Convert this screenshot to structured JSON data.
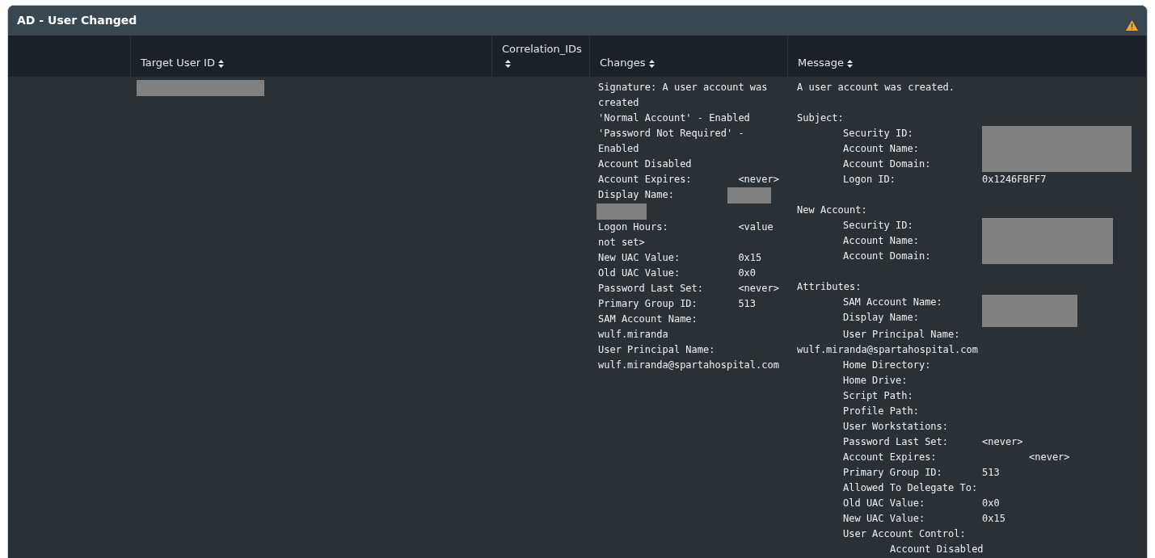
{
  "panel": {
    "title": "AD - User Changed",
    "warning": true
  },
  "columns": [
    {
      "label": "Target User ID"
    },
    {
      "label": "Correlation_IDs"
    },
    {
      "label": "Changes"
    },
    {
      "label": "Message"
    }
  ],
  "row": {
    "target_user_id": {
      "redacted": true
    },
    "changes": [
      {
        "kind": "text",
        "text": "Signature: A user account was created"
      },
      {
        "kind": "text",
        "text": "'Normal Account' - Enabled"
      },
      {
        "kind": "text",
        "text": "'Password Not Required' - Enabled"
      },
      {
        "kind": "text",
        "text": "Account Disabled"
      },
      {
        "kind": "text",
        "text": "Account Expires:        <never>"
      },
      {
        "kind": "redacted",
        "text": "Display Name:"
      },
      {
        "kind": "text",
        "text": "Logon Hours:            <value not set>"
      },
      {
        "kind": "text",
        "text": "New UAC Value:          0x15"
      },
      {
        "kind": "text",
        "text": "Old UAC Value:          0x0"
      },
      {
        "kind": "text",
        "text": "Password Last Set:      <never>"
      },
      {
        "kind": "text",
        "text": "Primary Group ID:       513"
      },
      {
        "kind": "text",
        "text": "SAM Account Name:       wulf.miranda"
      },
      {
        "kind": "text",
        "text": "User Principal Name:    wulf.miranda@spartahospital.com"
      }
    ],
    "message": {
      "intro": "A user account was created.",
      "sections": [
        {
          "heading": "Subject:",
          "fields": [
            {
              "label": "Security ID:",
              "redacted": true
            },
            {
              "label": "Account Name:",
              "redacted": true
            },
            {
              "label": "Account Domain:",
              "redacted": true
            },
            {
              "label": "Logon ID:",
              "value": "0x1246FBFF7"
            }
          ]
        },
        {
          "heading": "New Account:",
          "fields": [
            {
              "label": "Security ID:",
              "redacted": true
            },
            {
              "label": "Account Name:",
              "redacted": true
            },
            {
              "label": "Account Domain:",
              "redacted": true
            }
          ]
        },
        {
          "heading": "Attributes:",
          "fields": [
            {
              "label": "SAM Account Name:",
              "redacted": true
            },
            {
              "label": "Display Name:",
              "redacted": true
            },
            {
              "label": "User Principal Name:",
              "value": "wulf.miranda@spartahospital.com",
              "kind": "wrapped"
            },
            {
              "label": "Home Directory:"
            },
            {
              "label": "Home Drive:"
            },
            {
              "label": "Script Path:"
            },
            {
              "label": "Profile Path:"
            },
            {
              "label": "User Workstations:"
            },
            {
              "label": "Password Last Set:",
              "value": "<never>"
            },
            {
              "label": "Account Expires:",
              "value": "<never>",
              "kind": "offset"
            },
            {
              "label": "Primary Group ID:",
              "value": "513"
            },
            {
              "label": "Allowed To Delegate To:"
            },
            {
              "label": "Old UAC Value:",
              "value": "0x0"
            },
            {
              "label": "New UAC Value:",
              "value": "0x15"
            },
            {
              "label": "User Account Control:",
              "children": [
                {
                  "label": "Account Disabled"
                }
              ]
            }
          ]
        }
      ]
    }
  }
}
